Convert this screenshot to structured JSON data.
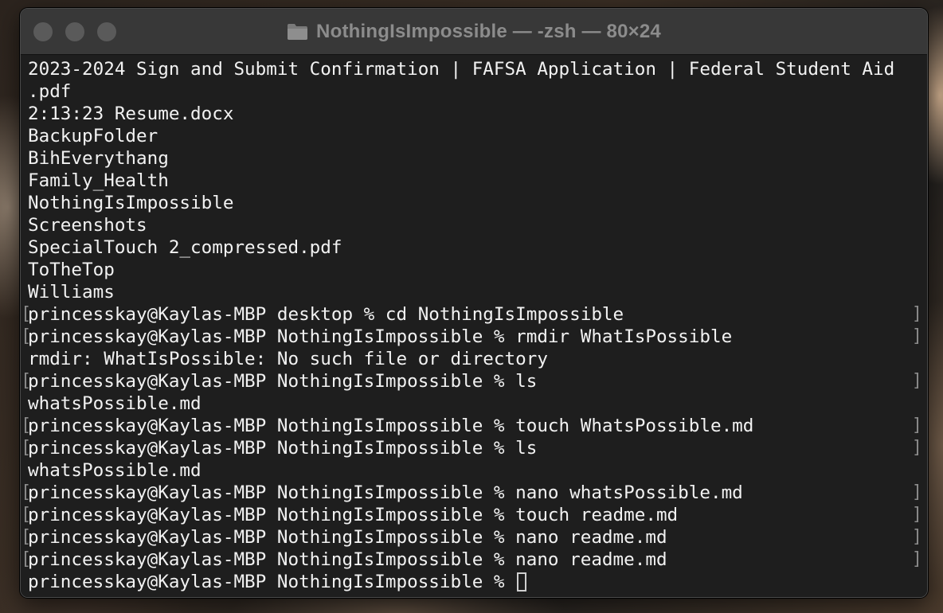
{
  "window": {
    "title": "NothingIsImpossible — -zsh — 80×24",
    "title_icon": "folder-icon"
  },
  "terminal": {
    "lines": [
      {
        "text": "2023-2024 Sign and Submit Confirmation | FAFSA Application | Federal Student Aid",
        "mark": false
      },
      {
        "text": ".pdf",
        "mark": false
      },
      {
        "text": "2:13:23 Resume.docx",
        "mark": false
      },
      {
        "text": "BackupFolder",
        "mark": false
      },
      {
        "text": "BihEverythang",
        "mark": false
      },
      {
        "text": "Family_Health",
        "mark": false
      },
      {
        "text": "NothingIsImpossible",
        "mark": false
      },
      {
        "text": "Screenshots",
        "mark": false
      },
      {
        "text": "SpecialTouch 2_compressed.pdf",
        "mark": false
      },
      {
        "text": "ToTheTop",
        "mark": false
      },
      {
        "text": "Williams",
        "mark": false
      },
      {
        "text": "princesskay@Kaylas-MBP desktop % cd NothingIsImpossible",
        "mark": true
      },
      {
        "text": "princesskay@Kaylas-MBP NothingIsImpossible % rmdir WhatIsPossible",
        "mark": true
      },
      {
        "text": "rmdir: WhatIsPossible: No such file or directory",
        "mark": false
      },
      {
        "text": "princesskay@Kaylas-MBP NothingIsImpossible % ls",
        "mark": true
      },
      {
        "text": "whatsPossible.md",
        "mark": false
      },
      {
        "text": "princesskay@Kaylas-MBP NothingIsImpossible % touch WhatsPossible.md",
        "mark": true
      },
      {
        "text": "princesskay@Kaylas-MBP NothingIsImpossible % ls",
        "mark": true
      },
      {
        "text": "whatsPossible.md",
        "mark": false
      },
      {
        "text": "princesskay@Kaylas-MBP NothingIsImpossible % nano whatsPossible.md",
        "mark": true
      },
      {
        "text": "princesskay@Kaylas-MBP NothingIsImpossible % touch readme.md",
        "mark": true
      },
      {
        "text": "princesskay@Kaylas-MBP NothingIsImpossible % nano readme.md",
        "mark": true
      },
      {
        "text": "princesskay@Kaylas-MBP NothingIsImpossible % nano readme.md",
        "mark": true
      }
    ],
    "prompt": "princesskay@Kaylas-MBP NothingIsImpossible % "
  }
}
